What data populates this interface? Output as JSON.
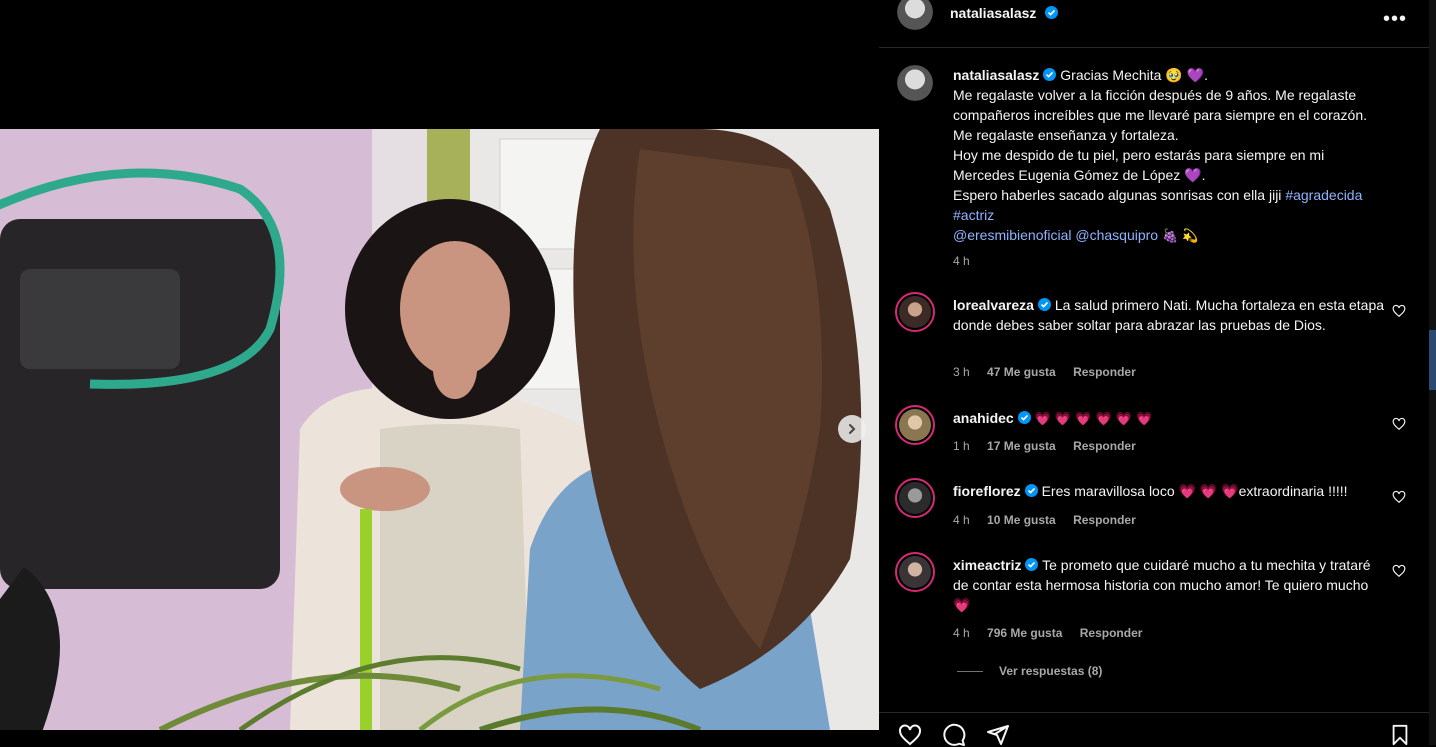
{
  "post": {
    "author": "nataliasalasz",
    "caption_lines": [
      "Gracias Mechita 🥹 💜.",
      "Me regalaste volver a la ficción después de 9 años. Me regalaste compañeros increíbles que me llevaré para siempre en el corazón. Me regalaste enseñanza y fortaleza.",
      "Hoy me despido de tu piel, pero estarás para siempre en mi Mercedes Eugenia Gómez de López 💜.",
      "Espero haberles sacado algunas sonrisas con ella jiji"
    ],
    "hashtags": [
      "#agradecida",
      "#actriz"
    ],
    "mentions": [
      "@eresmibienoficial",
      "@chasquipro"
    ],
    "mentions_emoji": "🍇 💫",
    "time": "4 h"
  },
  "comments": [
    {
      "user": "lorealvareza",
      "text": "La salud primero Nati. Mucha fortaleza en esta etapa donde debes saber soltar para abrazar las pruebas de Dios.",
      "time": "3 h",
      "likes": "47 Me gusta",
      "reply": "Responder"
    },
    {
      "user": "anahidec",
      "text": "💗 💗 💗 💗 💗 💗",
      "time": "1 h",
      "likes": "17 Me gusta",
      "reply": "Responder"
    },
    {
      "user": "fioreflorez",
      "text": "Eres maravillosa loco 💗 💗 💗extraordinaria !!!!!",
      "time": "4 h",
      "likes": "10 Me gusta",
      "reply": "Responder"
    },
    {
      "user": "ximeactriz",
      "text": "Te prometo que cuidaré mucho a tu mechita y trataré de contar esta hermosa historia con mucho amor! Te quiero mucho 💗",
      "time": "4 h",
      "likes": "796 Me gusta",
      "reply": "Responder"
    }
  ],
  "view_replies": "Ver respuestas (8)",
  "icons": {
    "more": "more-options-icon",
    "verified": "verified-badge-icon",
    "like": "heart-icon",
    "comment": "comment-icon",
    "share": "share-icon",
    "save": "bookmark-icon",
    "next": "chevron-right-icon"
  },
  "colors": {
    "verified": "#0095f6",
    "link": "#8fb3ff",
    "muted": "#a8a8a8"
  }
}
